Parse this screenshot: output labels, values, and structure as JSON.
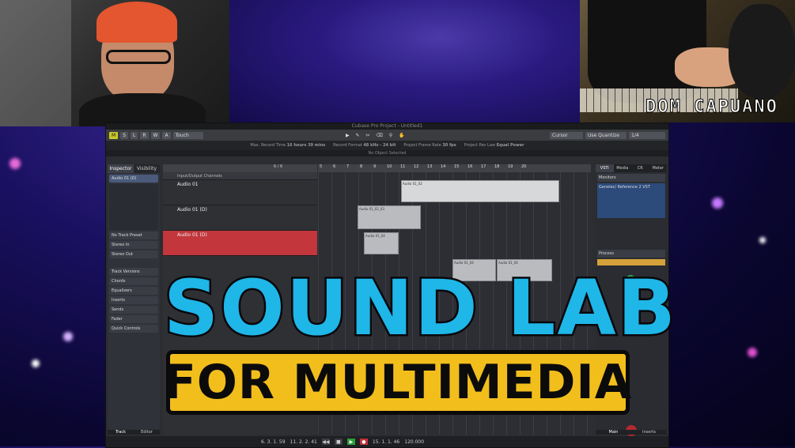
{
  "daw": {
    "window_title": "Cubase Pro Project - Untitled1",
    "toolbar": {
      "mode_m": "M",
      "mode_s": "S",
      "mode_l": "L",
      "mode_r": "R",
      "mode_w": "W",
      "mode_a": "A",
      "automation_mode": "Touch",
      "snap_type": "Cursor",
      "quantize_label": "Use Quantize",
      "quantize_value": "1/4"
    },
    "info_line": {
      "max_record_time": "Max. Record Time",
      "record_time_value": "16 hours 39 mins",
      "record_format": "Record Format",
      "record_format_value": "48 kHz - 24 bit",
      "frame_rate": "Project Frame Rate",
      "frame_rate_value": "30 fps",
      "pan_law": "Project Pan Law",
      "pan_law_value": "Equal Power"
    },
    "object_selection": "No Object Selected",
    "inspector": {
      "tab_inspector": "Inspector",
      "tab_visibility": "Visibility",
      "track_name": "Audio 01 (D)",
      "input": "Stereo In",
      "output": "Stereo Out",
      "no_preset": "No Track Preset",
      "sections": [
        "Track Versions",
        "Chords",
        "Equalizers",
        "Inserts",
        "Sends",
        "Fader",
        "Quick Controls"
      ]
    },
    "tracklist": {
      "count": "6 / 6",
      "folder": "Input/Output Channels",
      "tracks": [
        "Audio 01",
        "Audio 01 (D)",
        "Audio 01 (D)"
      ]
    },
    "ruler": [
      "5",
      "6",
      "7",
      "8",
      "9",
      "10",
      "11",
      "12",
      "13",
      "14",
      "15",
      "16",
      "17",
      "18",
      "19",
      "20"
    ],
    "clips": [
      "Audio 01_02",
      "Audio 01_02_03",
      "Audio 01_04",
      "Audio 01_04",
      "Audio 01_04"
    ],
    "right_zone": {
      "tabs": [
        "VSTi",
        "Media",
        "CR",
        "Meter"
      ],
      "monitors": "Monitors",
      "monitor_item": "Genelec/ Reference 2 VST",
      "process": "Process",
      "bottom_tabs": [
        "Main",
        "Inserts"
      ]
    },
    "left_zone_tabs": [
      "Track",
      "Editor"
    ],
    "transport": {
      "position_left": "6. 3. 1. 59",
      "position_right": "11. 2. 2. 41",
      "locator": "15. 1. 1. 46",
      "tempo": "120.000"
    }
  },
  "overlay": {
    "title": "SOUND LAB",
    "subtitle": "FOR MULTIMEDIA",
    "brand": "DOM CAPUANO"
  },
  "colors": {
    "title_blue": "#1fb6e8",
    "subtitle_box_yellow": "#f2be1c",
    "track_selected_red": "#c2363c",
    "play_green": "#2e9c3a",
    "record_red": "#c0303a"
  }
}
